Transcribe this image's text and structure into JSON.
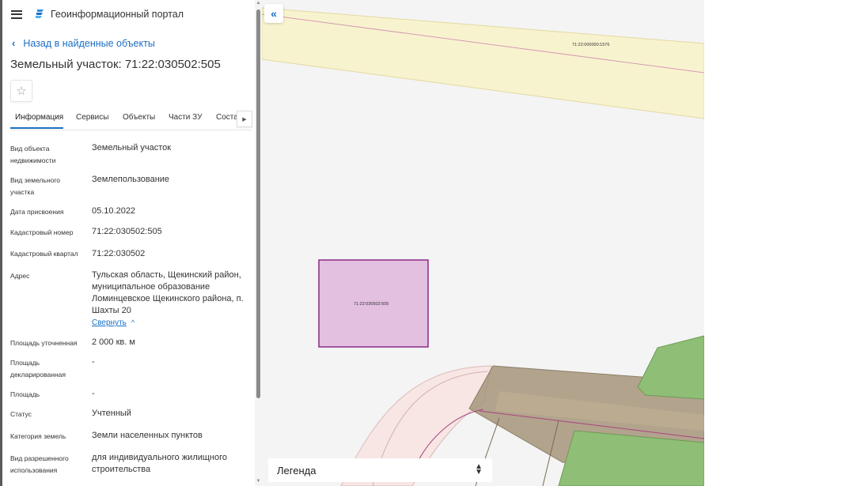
{
  "header": {
    "app_title": "Геоинформационный портал"
  },
  "back_link": "Назад в найденные объекты",
  "page_title": "Земельный участок: 71:22:030502:505",
  "tabs": [
    "Информация",
    "Сервисы",
    "Объекты",
    "Части ЗУ",
    "Соста"
  ],
  "fields": [
    {
      "label": "Вид объекта недвижимости",
      "value": "Земельный участок"
    },
    {
      "label": "Вид земельного участка",
      "value": "Землепользование"
    },
    {
      "label": "Дата присвоения",
      "value": "05.10.2022"
    },
    {
      "label": "Кадастровый номер",
      "value": "71:22:030502:505"
    },
    {
      "label": "Кадастровый квартал",
      "value": "71:22:030502"
    },
    {
      "label": "Адрес",
      "value": "Тульская область, Щекинский район, муниципальное образование Ломинцевское Щекинского района, п. Шахты 20"
    },
    {
      "label": "Площадь уточненная",
      "value": "2 000 кв. м"
    },
    {
      "label": "Площадь декларированная",
      "value": "-"
    },
    {
      "label": "Площадь",
      "value": "-"
    },
    {
      "label": "Статус",
      "value": "Учтенный"
    },
    {
      "label": "Категория земель",
      "value": "Земли населенных пунктов"
    },
    {
      "label": "Вид разрешенного использования",
      "value": "для индивидуального жилищного строительства"
    }
  ],
  "address_toggle": "Свернуть",
  "map": {
    "road_label": "71:22:000000:1576",
    "parcel_label": "71:22:030502:505",
    "legend_title": "Легенда"
  },
  "colors": {
    "accent": "#1c6fc5",
    "parcel_fill": "#e3bfe0",
    "parcel_stroke": "#8a2a88",
    "road_fill": "#f8f3cf",
    "land_brown": "#a7957c",
    "land_green": "#8fbf76"
  },
  "icons": {
    "menu": "menu-icon",
    "logo": "portal-logo-icon",
    "back": "chevron-left-icon",
    "favorite": "star-icon",
    "tabs_next": "chevron-right-icon",
    "collapse": "double-chevron-left-icon",
    "legend_toggle": "sort-arrows-icon"
  }
}
